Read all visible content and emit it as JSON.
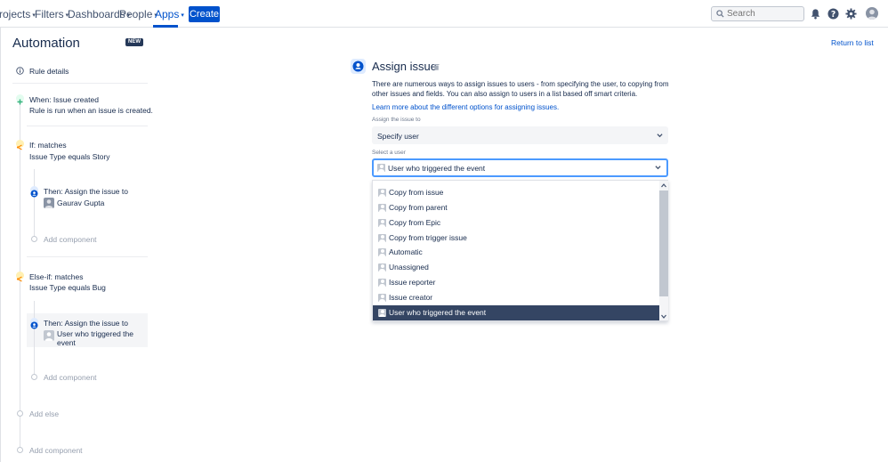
{
  "nav": {
    "items": [
      {
        "label": "rojects"
      },
      {
        "label": "Filters"
      },
      {
        "label": "Dashboards"
      },
      {
        "label": "People"
      },
      {
        "label": "Apps"
      }
    ],
    "create_label": "Create",
    "search_placeholder": "Search"
  },
  "sidebar": {
    "title": "Automation",
    "badge": "NEW",
    "rule_details": "Rule details",
    "trigger": {
      "title": "When: Issue created",
      "desc": "Rule is run when an issue is created."
    },
    "if_block": {
      "title": "If: matches",
      "desc": "Issue Type equals Story"
    },
    "then1": {
      "title": "Then: Assign the issue to",
      "user": "Gaurav Gupta"
    },
    "add_component": "Add component",
    "elseif_block": {
      "title": "Else-if: matches",
      "desc": "Issue Type equals Bug"
    },
    "then2": {
      "title": "Then: Assign the issue to",
      "user_line1": "User who triggered the",
      "user_line2": "event"
    },
    "add_else": "Add else"
  },
  "main": {
    "return_link": "Return to list",
    "title": "Assign issue",
    "description": "There are numerous ways to assign issues to users - from specifying the user, to copying from other issues and fields. You can also assign to users in a list based off smart criteria.",
    "learn_more": "Learn more about the different options for assigning issues.",
    "assign_label": "Assign the issue to",
    "assign_value": "Specify user",
    "select_user_label": "Select a user",
    "select_user_value": "User who triggered the event",
    "options": [
      {
        "label": "Copy from issue"
      },
      {
        "label": "Copy from parent"
      },
      {
        "label": "Copy from Epic"
      },
      {
        "label": "Copy from trigger issue"
      },
      {
        "label": "Automatic"
      },
      {
        "label": "Unassigned"
      },
      {
        "label": "Issue reporter"
      },
      {
        "label": "Issue creator"
      },
      {
        "label": "User who triggered the event",
        "selected": true
      }
    ]
  },
  "colors": {
    "primary": "#0052cc",
    "selected_option": "#344563",
    "focus_border": "#4c9aff",
    "trigger_green": "#36b37e",
    "condition_yellow": "#ffab00",
    "action_blue": "#0052cc"
  },
  "icons": [
    "search-icon",
    "bell-icon",
    "help-icon",
    "gear-icon",
    "info-icon",
    "chevron-down-icon",
    "trash-icon",
    "user-icon"
  ]
}
